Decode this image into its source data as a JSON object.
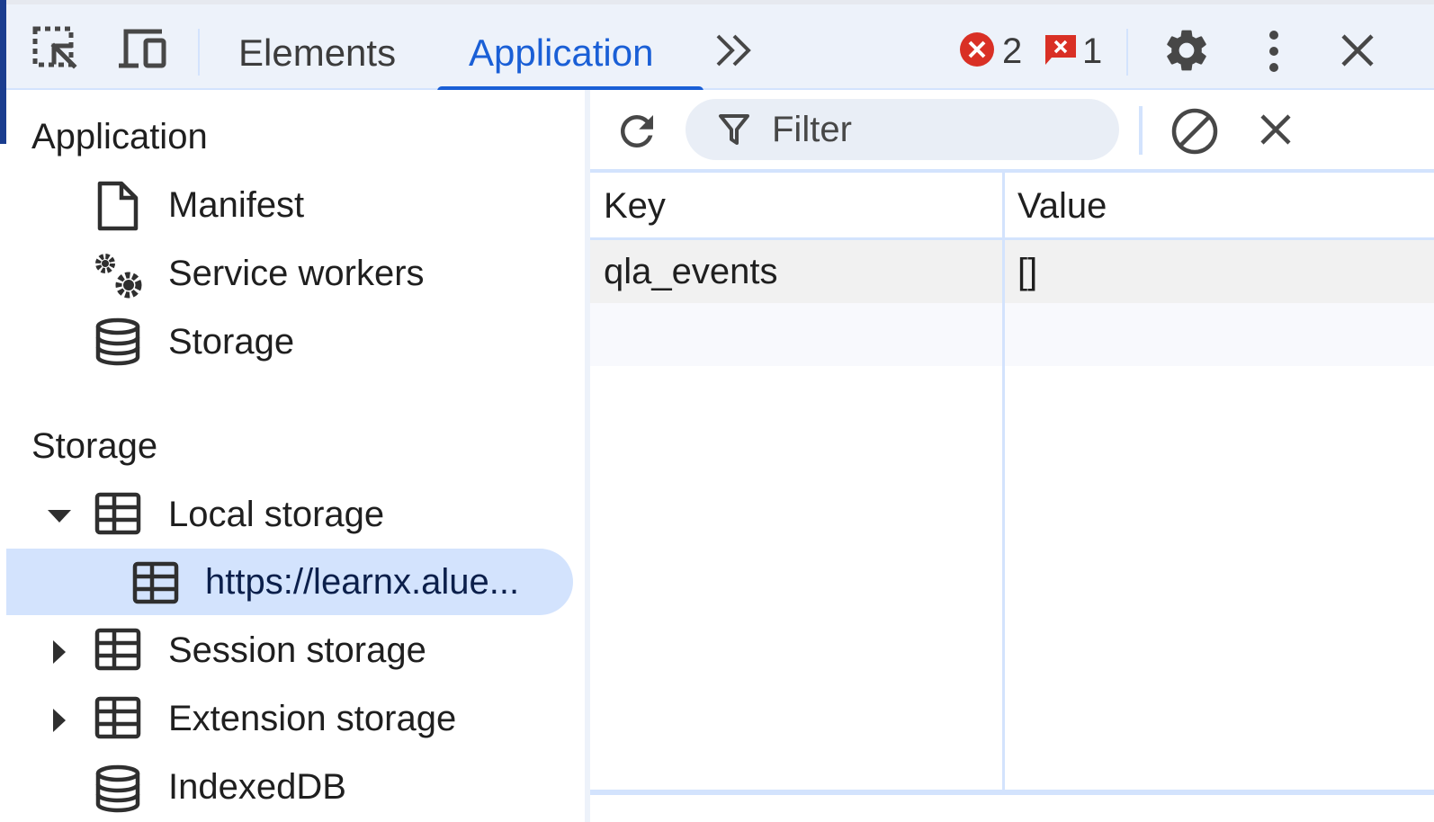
{
  "toolbar": {
    "tabs": [
      {
        "label": "Elements",
        "active": false
      },
      {
        "label": "Application",
        "active": true
      }
    ],
    "error_count": "2",
    "issue_count": "1",
    "icons": [
      "inspect-icon",
      "device-toolbar-icon",
      "more-tabs-icon",
      "error-icon",
      "issue-icon",
      "settings-icon",
      "more-options-icon",
      "close-icon"
    ],
    "accent_color": "#1a5fd6"
  },
  "sidebar": {
    "sections": [
      {
        "title": "Application",
        "items": [
          {
            "label": "Manifest",
            "icon": "document-icon"
          },
          {
            "label": "Service workers",
            "icon": "gears-icon"
          },
          {
            "label": "Storage",
            "icon": "database-icon"
          }
        ]
      },
      {
        "title": "Storage",
        "items": [
          {
            "label": "Local storage",
            "icon": "table-icon",
            "expanded": true
          },
          {
            "label": "https://learnx.alue...",
            "icon": "table-icon",
            "selected": true
          },
          {
            "label": "Session storage",
            "icon": "table-icon",
            "expanded": false
          },
          {
            "label": "Extension storage",
            "icon": "table-icon",
            "expanded": false
          },
          {
            "label": "IndexedDB",
            "icon": "database-icon"
          }
        ]
      }
    ]
  },
  "storage_view": {
    "filter_placeholder": "Filter",
    "columns": [
      "Key",
      "Value"
    ],
    "rows": [
      {
        "key": "qla_events",
        "value": "[]"
      }
    ]
  }
}
